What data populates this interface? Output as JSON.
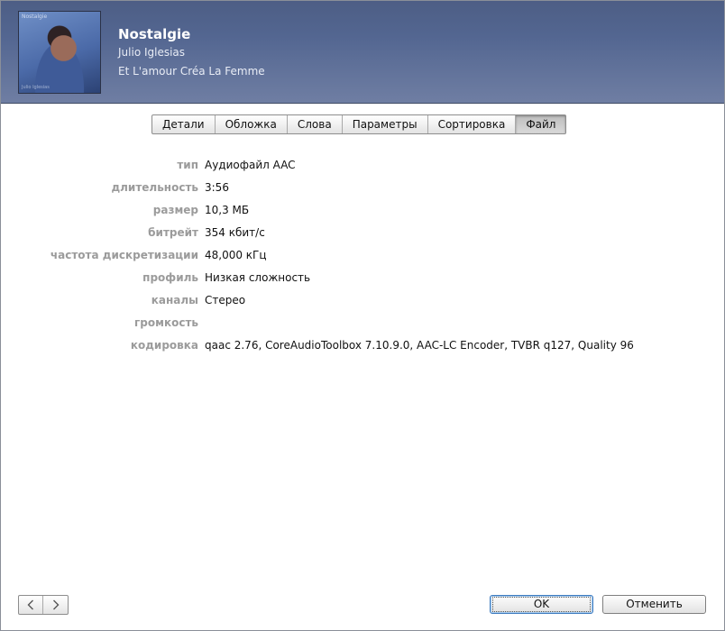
{
  "header": {
    "artwork_label": "Nostalgie",
    "artwork_sub": "Julio Iglesias",
    "title": "Nostalgie",
    "artist": "Julio Iglesias",
    "album": "Et L'amour Créa La Femme"
  },
  "tabs": [
    {
      "label": "Детали",
      "active": false
    },
    {
      "label": "Обложка",
      "active": false
    },
    {
      "label": "Слова",
      "active": false
    },
    {
      "label": "Параметры",
      "active": false
    },
    {
      "label": "Сортировка",
      "active": false
    },
    {
      "label": "Файл",
      "active": true
    }
  ],
  "fields": [
    {
      "label": "тип",
      "value": "Аудиофайл AAC"
    },
    {
      "label": "длительность",
      "value": "3:56"
    },
    {
      "label": "размер",
      "value": "10,3 МБ"
    },
    {
      "label": "битрейт",
      "value": "354 кбит/с"
    },
    {
      "label": "частота дискретизации",
      "value": "48,000 кГц"
    },
    {
      "label": "профиль",
      "value": "Низкая сложность"
    },
    {
      "label": "каналы",
      "value": "Стерео"
    },
    {
      "label": "громкость",
      "value": ""
    },
    {
      "label": "кодировка",
      "value": "qaac 2.76, CoreAudioToolbox 7.10.9.0, AAC-LC Encoder, TVBR q127, Quality 96"
    }
  ],
  "footer": {
    "prev_icon": "chevron-left-icon",
    "next_icon": "chevron-right-icon",
    "ok_label": "OK",
    "cancel_label": "Отменить"
  }
}
